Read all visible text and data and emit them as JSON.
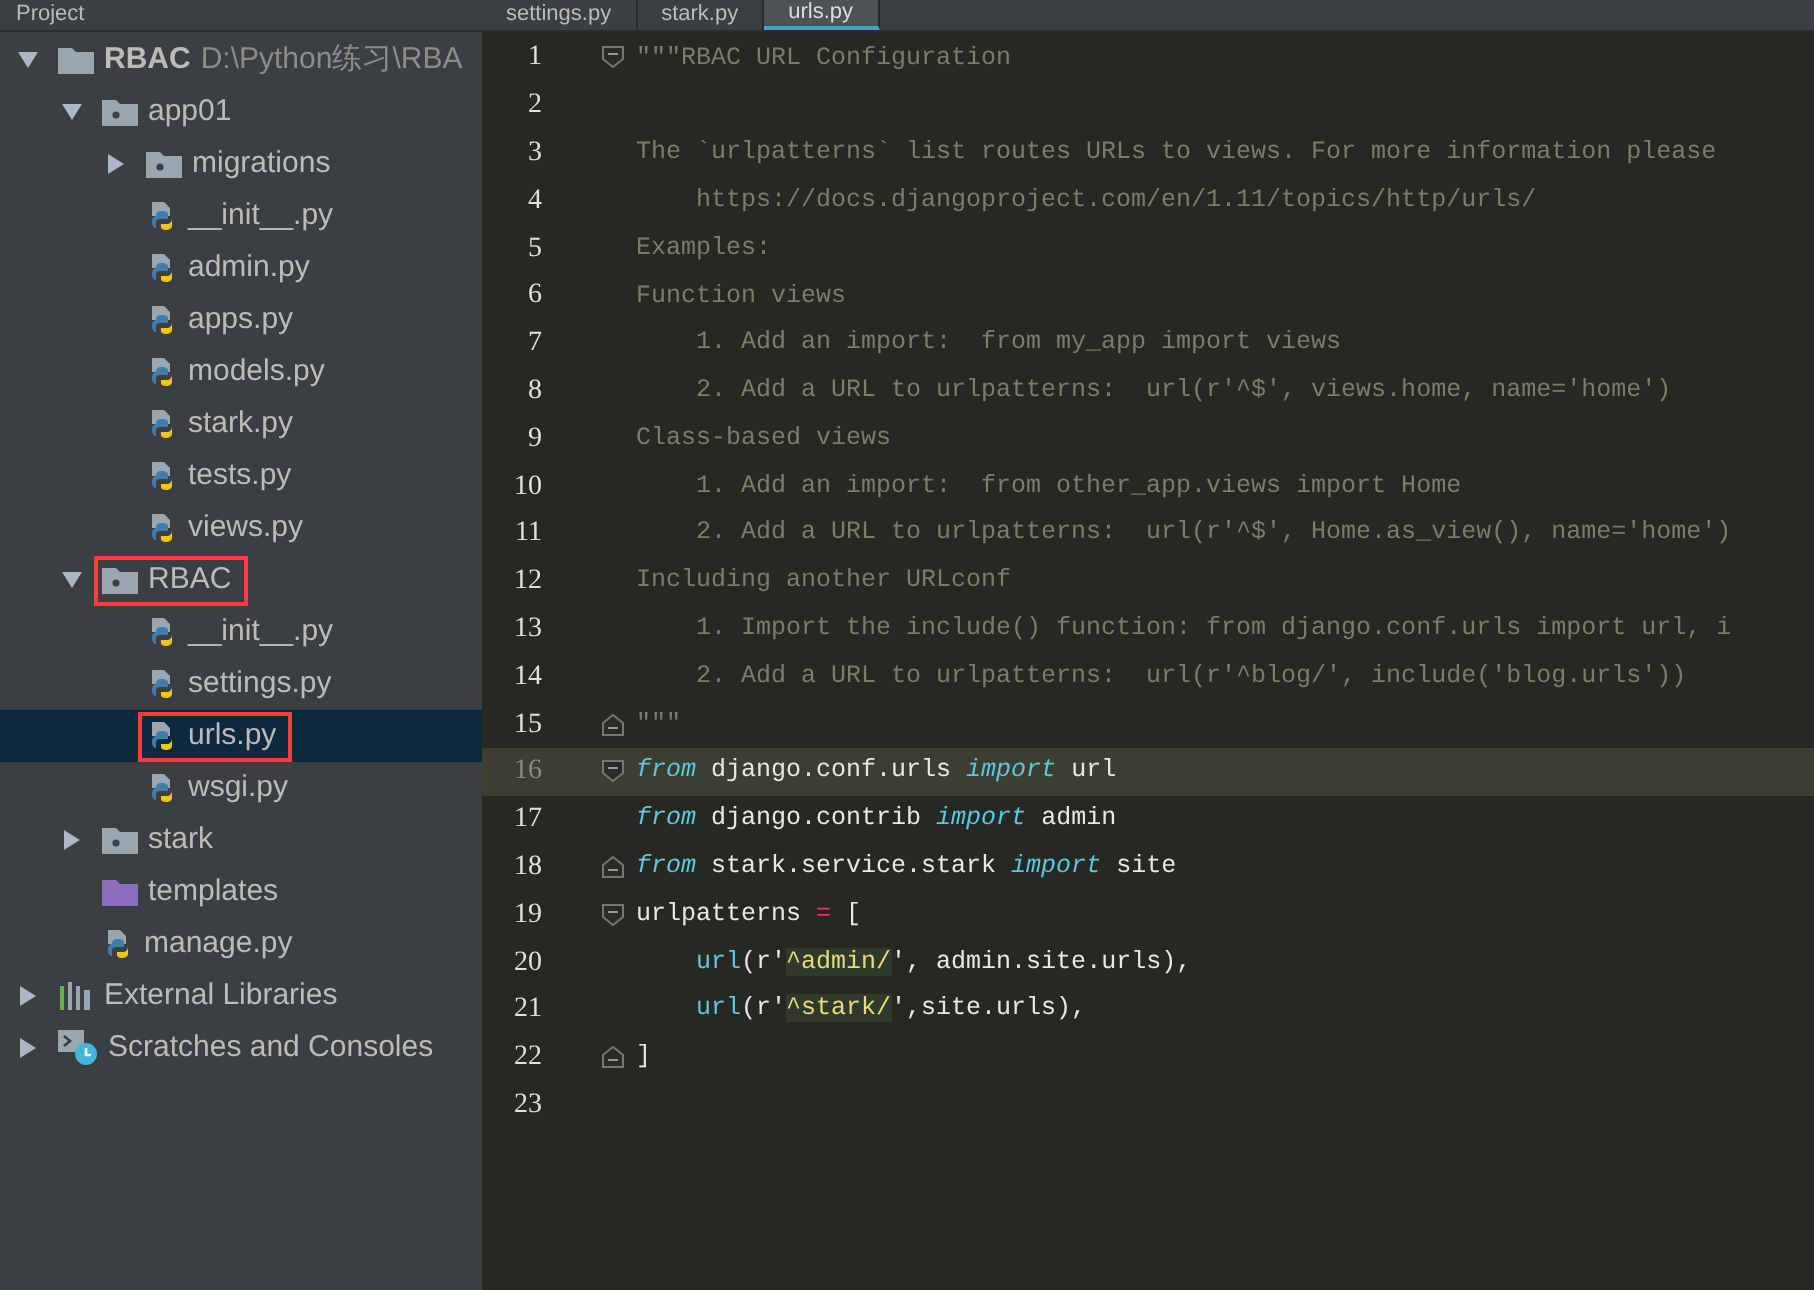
{
  "toolbar": {
    "title": "Project"
  },
  "tabs": [
    {
      "label": "settings.py",
      "selected": false
    },
    {
      "label": "stark.py",
      "selected": false
    },
    {
      "label": "urls.py",
      "selected": true
    }
  ],
  "tree": [
    {
      "kind": "root",
      "label": "RBAC",
      "path": "D:\\Python练习\\RBA",
      "expanded": true,
      "selected": false,
      "outlined": false,
      "children": [
        {
          "kind": "package",
          "label": "app01",
          "expanded": true,
          "selected": false,
          "outlined": false,
          "children": [
            {
              "kind": "package",
              "label": "migrations",
              "expanded": false,
              "selected": false,
              "outlined": false
            },
            {
              "kind": "python",
              "label": "__init__.py",
              "selected": false,
              "outlined": false
            },
            {
              "kind": "python",
              "label": "admin.py",
              "selected": false,
              "outlined": false
            },
            {
              "kind": "python",
              "label": "apps.py",
              "selected": false,
              "outlined": false
            },
            {
              "kind": "python",
              "label": "models.py",
              "selected": false,
              "outlined": false
            },
            {
              "kind": "python",
              "label": "stark.py",
              "selected": false,
              "outlined": false
            },
            {
              "kind": "python",
              "label": "tests.py",
              "selected": false,
              "outlined": false
            },
            {
              "kind": "python",
              "label": "views.py",
              "selected": false,
              "outlined": false
            }
          ]
        },
        {
          "kind": "package",
          "label": "RBAC",
          "expanded": true,
          "selected": false,
          "outlined": true,
          "children": [
            {
              "kind": "python",
              "label": "__init__.py",
              "selected": false,
              "outlined": false
            },
            {
              "kind": "python",
              "label": "settings.py",
              "selected": false,
              "outlined": false
            },
            {
              "kind": "python",
              "label": "urls.py",
              "selected": true,
              "outlined": true
            },
            {
              "kind": "python",
              "label": "wsgi.py",
              "selected": false,
              "outlined": false
            }
          ]
        },
        {
          "kind": "package",
          "label": "stark",
          "expanded": false,
          "selected": false,
          "outlined": false
        },
        {
          "kind": "templates",
          "label": "templates",
          "selected": false,
          "outlined": false
        },
        {
          "kind": "python",
          "label": "manage.py",
          "selected": false,
          "outlined": false
        }
      ]
    },
    {
      "kind": "libraries",
      "label": "External Libraries",
      "expanded": false,
      "selected": false,
      "outlined": false
    },
    {
      "kind": "scratches",
      "label": "Scratches and Consoles",
      "expanded": false,
      "selected": false,
      "outlined": false
    }
  ],
  "editor": {
    "lines": [
      {
        "number": "1",
        "fold_start": true,
        "fold_end": false,
        "current": false,
        "tokens": [
          {
            "kind": "comment",
            "text": "\"\"\"RBAC URL Configuration"
          }
        ]
      },
      {
        "number": "2",
        "fold_start": false,
        "fold_end": false,
        "current": false
      },
      {
        "number": "3",
        "fold_start": false,
        "fold_end": false,
        "current": false,
        "tokens": [
          {
            "kind": "comment",
            "text": "The `urlpatterns` list routes URLs to views. For more information please"
          }
        ]
      },
      {
        "number": "4",
        "fold_start": false,
        "fold_end": false,
        "current": false,
        "tokens": [
          {
            "kind": "comment",
            "text": "    https://docs.djangoproject.com/en/1.11/topics/http/urls/"
          }
        ]
      },
      {
        "number": "5",
        "fold_start": false,
        "fold_end": false,
        "current": false,
        "tokens": [
          {
            "kind": "comment",
            "text": "Examples:"
          }
        ]
      },
      {
        "number": "6",
        "fold_start": false,
        "fold_end": false,
        "current": false,
        "tokens": [
          {
            "kind": "comment",
            "text": "Function views"
          }
        ]
      },
      {
        "number": "7",
        "fold_start": false,
        "fold_end": false,
        "current": false,
        "tokens": [
          {
            "kind": "comment",
            "text": "    1. Add an import:  from my_app import views"
          }
        ]
      },
      {
        "number": "8",
        "fold_start": false,
        "fold_end": false,
        "current": false,
        "tokens": [
          {
            "kind": "comment",
            "text": "    2. Add a URL to urlpatterns:  url(r'^$', views.home, name='home')"
          }
        ]
      },
      {
        "number": "9",
        "fold_start": false,
        "fold_end": false,
        "current": false,
        "tokens": [
          {
            "kind": "comment",
            "text": "Class-based views"
          }
        ]
      },
      {
        "number": "10",
        "fold_start": false,
        "fold_end": false,
        "current": false,
        "tokens": [
          {
            "kind": "comment",
            "text": "    1. Add an import:  from other_app.views import Home"
          }
        ]
      },
      {
        "number": "11",
        "fold_start": false,
        "fold_end": false,
        "current": false,
        "tokens": [
          {
            "kind": "comment",
            "text": "    2. Add a URL to urlpatterns:  url(r'^$', Home.as_view(), name='home')"
          }
        ]
      },
      {
        "number": "12",
        "fold_start": false,
        "fold_end": false,
        "current": false,
        "tokens": [
          {
            "kind": "comment",
            "text": "Including another URLconf"
          }
        ]
      },
      {
        "number": "13",
        "fold_start": false,
        "fold_end": false,
        "current": false,
        "tokens": [
          {
            "kind": "comment",
            "text": "    1. Import the include() function: from django.conf.urls import url, i"
          }
        ]
      },
      {
        "number": "14",
        "fold_start": false,
        "fold_end": false,
        "current": false,
        "tokens": [
          {
            "kind": "comment",
            "text": "    2. Add a URL to urlpatterns:  url(r'^blog/', include('blog.urls'))"
          }
        ]
      },
      {
        "number": "15",
        "fold_start": false,
        "fold_end": true,
        "current": false,
        "tokens": [
          {
            "kind": "comment",
            "text": "\"\"\""
          }
        ]
      },
      {
        "number": "16",
        "fold_start": true,
        "fold_end": false,
        "current": true,
        "tokens": [
          {
            "kind": "keyword",
            "text": "from"
          },
          {
            "kind": "plain",
            "text": " django.conf.urls "
          },
          {
            "kind": "keyword",
            "text": "import"
          },
          {
            "kind": "plain",
            "text": " url"
          }
        ]
      },
      {
        "number": "17",
        "fold_start": false,
        "fold_end": false,
        "current": false,
        "tokens": [
          {
            "kind": "keyword",
            "text": "from"
          },
          {
            "kind": "plain",
            "text": " django.contrib "
          },
          {
            "kind": "keyword",
            "text": "import"
          },
          {
            "kind": "plain",
            "text": " admin"
          }
        ]
      },
      {
        "number": "18",
        "fold_start": false,
        "fold_end": true,
        "current": false,
        "tokens": [
          {
            "kind": "keyword",
            "text": "from"
          },
          {
            "kind": "plain",
            "text": " stark.service.stark "
          },
          {
            "kind": "keyword",
            "text": "import"
          },
          {
            "kind": "plain",
            "text": " site"
          }
        ]
      },
      {
        "number": "19",
        "fold_start": true,
        "fold_end": false,
        "current": false,
        "tokens": [
          {
            "kind": "plain",
            "text": "urlpatterns "
          },
          {
            "kind": "operator",
            "text": "="
          },
          {
            "kind": "plain",
            "text": " ["
          }
        ]
      },
      {
        "number": "20",
        "fold_start": false,
        "fold_end": false,
        "current": false,
        "tokens": [
          {
            "kind": "builtin",
            "text": "    url"
          },
          {
            "kind": "plain",
            "text": "(r'"
          },
          {
            "kind": "regex",
            "text": "^admin/"
          },
          {
            "kind": "plain",
            "text": "', admin.site.urls),"
          }
        ]
      },
      {
        "number": "21",
        "fold_start": false,
        "fold_end": false,
        "current": false,
        "tokens": [
          {
            "kind": "builtin",
            "text": "    url"
          },
          {
            "kind": "plain",
            "text": "(r'"
          },
          {
            "kind": "regex",
            "text": "^stark/"
          },
          {
            "kind": "plain",
            "text": "',site.urls),"
          }
        ]
      },
      {
        "number": "22",
        "fold_start": false,
        "fold_end": true,
        "current": false,
        "tokens": [
          {
            "kind": "plain",
            "text": "]"
          }
        ]
      },
      {
        "number": "23",
        "fold_start": false,
        "fold_end": false,
        "current": false
      }
    ]
  }
}
